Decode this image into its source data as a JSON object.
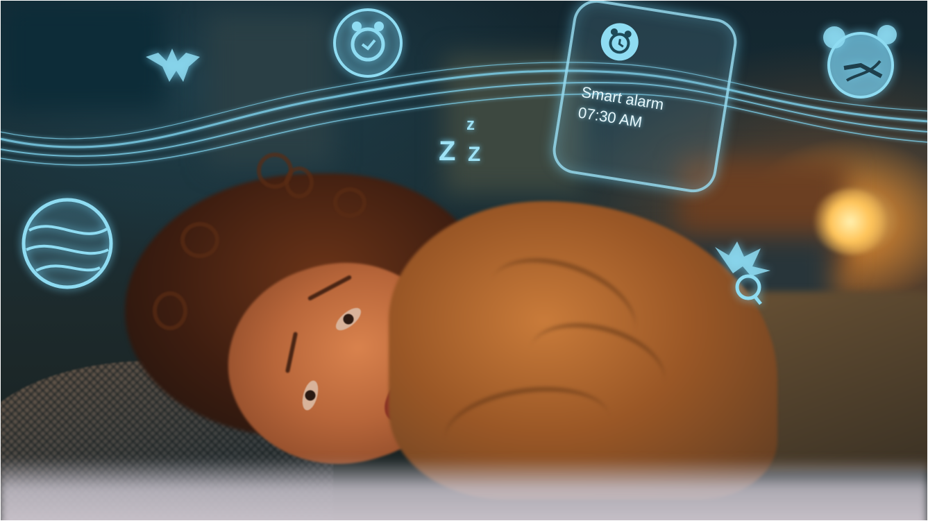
{
  "image": {
    "subject": "Smart alarm",
    "alarm_card": {
      "title": "Smart alarm",
      "time": "07:30 AM",
      "icon": "alarm-clock-face-icon"
    },
    "sleep_symbol": {
      "big": "Z",
      "small": "Z",
      "tiny": "z"
    },
    "floating_icons": [
      "alarm-clock-icon",
      "bat-icon",
      "globe-icon",
      "alarm-clock-icon",
      "bird-icon"
    ],
    "colors": {
      "hologram": "#8fdcf2",
      "lamp": "#ffc45a",
      "sweater": "#c97b3a"
    }
  }
}
